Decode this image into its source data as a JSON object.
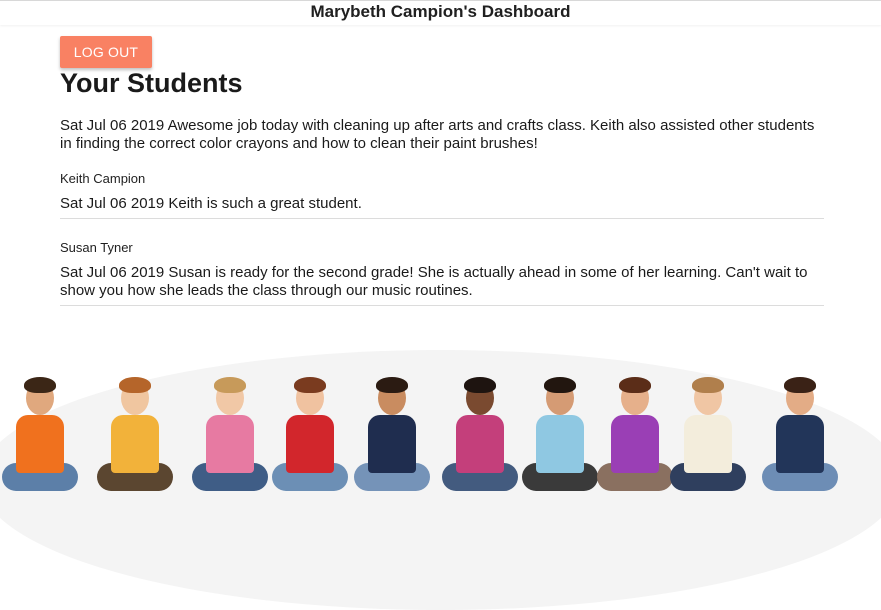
{
  "header": {
    "title": "Marybeth Campion's Dashboard"
  },
  "actions": {
    "logout_label": "LOG OUT"
  },
  "main": {
    "title": "Your Students",
    "intro_note": "Sat Jul 06 2019 Awesome job today with cleaning up after arts and crafts class. Keith also assisted other students in finding the correct color crayons and how to clean their paint brushes!",
    "students": [
      {
        "name": "Keith Campion",
        "note": "Sat Jul 06 2019 Keith is such a great student."
      },
      {
        "name": "Susan Tyner",
        "note": "Sat Jul 06 2019 Susan is ready for the second grade! She is actually ahead in some of her learning. Can't wait to show you how she leads the class through our music routines."
      }
    ]
  },
  "colors": {
    "accent": "#f98163",
    "text": "#1a1a1a",
    "divider": "#dcdcdc"
  },
  "banner": {
    "icon": "children-sitting-illustration"
  }
}
